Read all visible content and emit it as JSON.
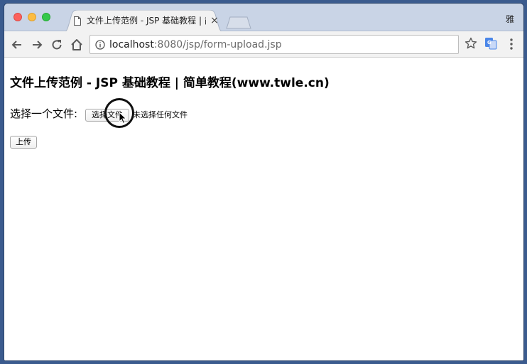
{
  "browser": {
    "tab": {
      "title": "文件上传范例 - JSP 基础教程 | 简单教程(www.twle.cn)",
      "close": "×"
    },
    "profile_label": "雅",
    "address": {
      "host": "localhost",
      "rest": ":8080/jsp/form-upload.jsp"
    },
    "icons": {
      "back": "back-arrow-icon",
      "forward": "forward-arrow-icon",
      "reload": "reload-icon",
      "home": "home-icon",
      "info": "info-icon",
      "star": "bookmark-star-icon",
      "translate": "translate-icon",
      "menu": "kebab-menu-icon"
    }
  },
  "page": {
    "heading": "文件上传范例 - JSP 基础教程 | 简单教程(www.twle.cn)",
    "file_field_label": "选择一个文件:",
    "choose_file_button": "选择文件",
    "no_file_text": "未选择任何文件",
    "upload_button": "上传"
  },
  "colors": {
    "tabstrip": "#c9d4e6",
    "toolbar": "#f2f2f2",
    "desktop": "#3b5b8e"
  }
}
